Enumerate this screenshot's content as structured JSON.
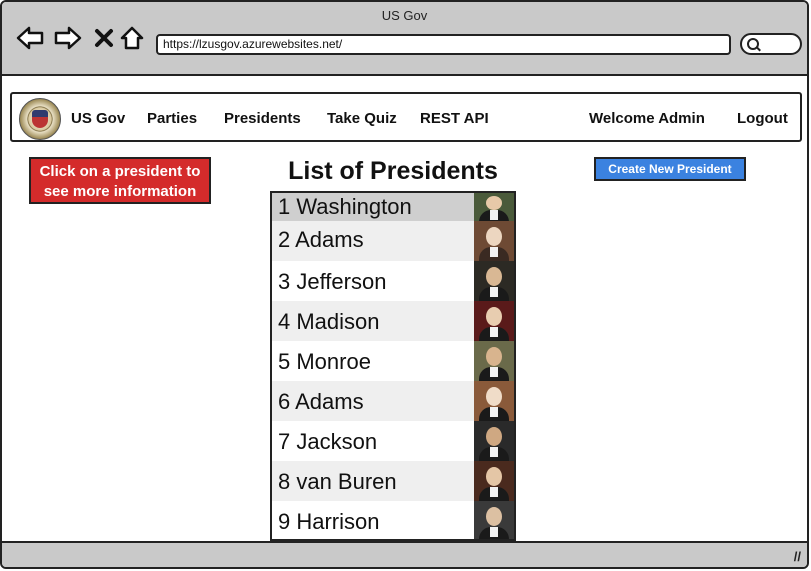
{
  "window": {
    "title": "US Gov"
  },
  "toolbar": {
    "back_icon": "back-arrow-icon",
    "forward_icon": "forward-arrow-icon",
    "stop_icon": "close-icon",
    "home_icon": "home-icon",
    "url": "https://lzusgov.azurewebsites.net/",
    "search_icon": "search-icon"
  },
  "navbar": {
    "brand": "US Gov",
    "items": [
      "Parties",
      "Presidents",
      "Take Quiz",
      "REST API"
    ],
    "welcome": "Welcome Admin",
    "logout": "Logout"
  },
  "note": {
    "line1": "Click on a president to",
    "line2": "see more information"
  },
  "list": {
    "title": "List of Presidents",
    "create_button": "Create New President",
    "presidents": [
      "1 Washington",
      "2 Adams",
      "3 Jefferson",
      "4 Madison",
      "5 Monroe",
      "6 Adams",
      "7 Jackson",
      "8 van Buren",
      "9 Harrison"
    ]
  },
  "colors": {
    "chrome_bg": "#c9c9c9",
    "note_bg": "#d42b2b",
    "button_bg": "#3b82e0",
    "row_alt": "#efefef",
    "row_selected": "#cfcfcf"
  }
}
